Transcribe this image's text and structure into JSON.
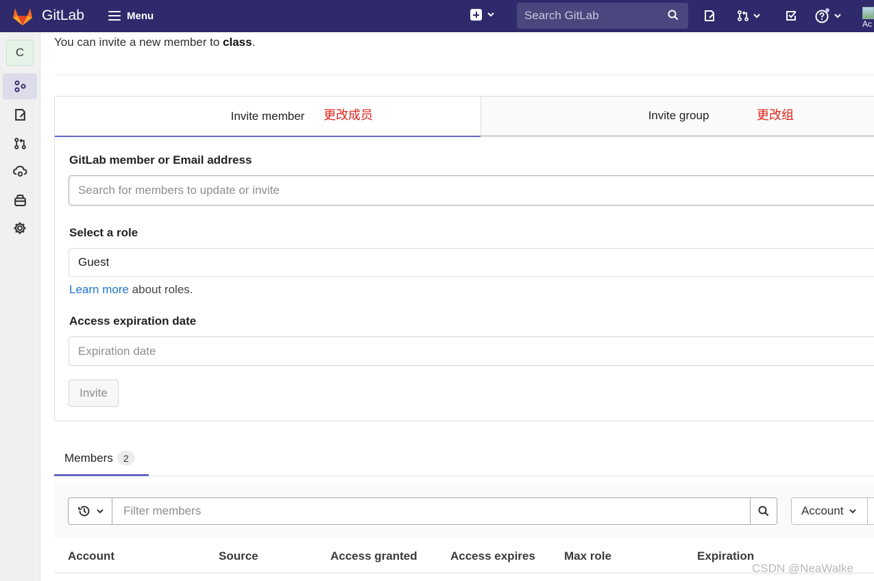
{
  "navbar": {
    "brand": "GitLab",
    "menu_label": "Menu",
    "search_placeholder": "Search GitLab",
    "avatar_alt_text": "Ac",
    "colors": {
      "background": "#2f2a6b",
      "search_bg": "#4b467d"
    }
  },
  "sidebar": {
    "project_initial": "C",
    "items": [
      {
        "icon": "project-overview-icon",
        "active": true
      },
      {
        "icon": "issues-icon",
        "active": false
      },
      {
        "icon": "merge-requests-icon",
        "active": false
      },
      {
        "icon": "deployments-icon",
        "active": false
      },
      {
        "icon": "packages-icon",
        "active": false
      },
      {
        "icon": "settings-icon",
        "active": false
      }
    ]
  },
  "intro": {
    "prefix": "You can invite a new member to ",
    "target": "class",
    "suffix": "."
  },
  "invite_tabs": [
    {
      "label": "Invite member",
      "note": "更改成员",
      "active": true
    },
    {
      "label": "Invite group",
      "note": "更改组",
      "active": false
    }
  ],
  "form": {
    "member_label": "GitLab member or Email address",
    "member_placeholder": "Search for members to update or invite",
    "role_label": "Select a role",
    "role_value": "Guest",
    "learn_more_link": "Learn more",
    "learn_more_suffix": " about roles.",
    "expiration_label": "Access expiration date",
    "expiration_placeholder": "Expiration date",
    "invite_button": "Invite"
  },
  "members": {
    "tab_label": "Members",
    "count": "2",
    "filter_placeholder": "Filter members",
    "sort_label": "Account",
    "columns": [
      "Account",
      "Source",
      "Access granted",
      "Access expires",
      "Max role",
      "Expiration"
    ]
  },
  "watermark": "CSDN @NeaWalke",
  "colors": {
    "accent": "#6666c4",
    "link": "#1f75cb",
    "annotation": "#e2231a"
  }
}
